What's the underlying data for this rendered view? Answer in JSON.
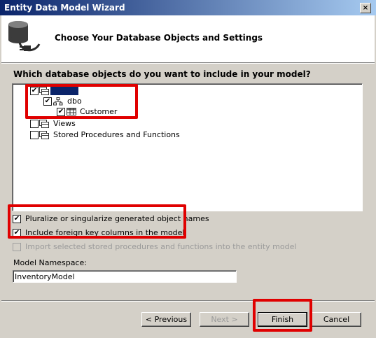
{
  "window": {
    "title": "Entity Data Model Wizard",
    "close_glyph": "×"
  },
  "header": {
    "title": "Choose Your Database Objects and Settings",
    "icon": "database-plug-icon"
  },
  "objects": {
    "question": "Which database objects do you want to include in your model?",
    "tree": {
      "root": {
        "label": "",
        "checked": true,
        "selected": true
      },
      "schema": {
        "label": "dbo",
        "checked": true
      },
      "table": {
        "label": "Customer",
        "checked": true
      },
      "views": {
        "label": "Views",
        "checked": false
      },
      "procedures": {
        "label": "Stored Procedures and Functions",
        "checked": false
      }
    }
  },
  "options": {
    "pluralize": {
      "label": "Pluralize or singularize generated object names",
      "checked": true
    },
    "foreign_keys": {
      "label": "Include foreign key columns in the model",
      "checked": true
    },
    "import_procs": {
      "label": "Import selected stored procedures and functions into the entity model",
      "checked": false,
      "enabled": false
    }
  },
  "namespace": {
    "label": "Model Namespace:",
    "value": "InventoryModel"
  },
  "buttons": {
    "previous": "< Previous",
    "next": "Next >",
    "finish": "Finish",
    "cancel": "Cancel"
  },
  "colors": {
    "highlight": "#e00000",
    "selection": "#0a246a",
    "dialog": "#d4d0c8"
  },
  "check_glyph": "✔"
}
